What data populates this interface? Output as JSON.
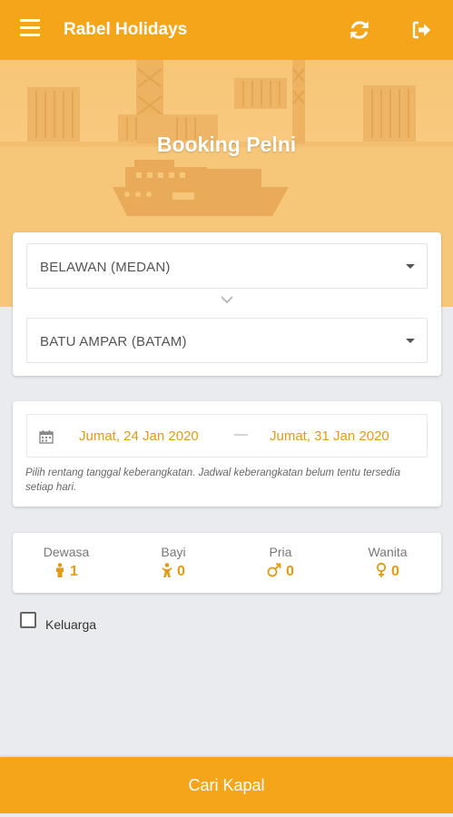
{
  "appbar": {
    "title": "Rabel Holidays",
    "icons": [
      "menu-icon",
      "refresh-icon",
      "logout-icon"
    ]
  },
  "hero": {
    "heading": "Booking Pelni"
  },
  "route": {
    "from": "BELAWAN (MEDAN)",
    "to": "BATU AMPAR (BATAM)"
  },
  "dates": {
    "start": "Jumat, 24 Jan 2020",
    "separator": "—",
    "end": "Jumat, 31 Jan 2020",
    "hint": "Pilih rentang tanggal keberangkatan. Jadwal keberangkatan belum tentu tersedia setiap hari."
  },
  "passengers": [
    {
      "label": "Dewasa",
      "count": "1",
      "icon": "adult-icon"
    },
    {
      "label": "Bayi",
      "count": "0",
      "icon": "infant-icon"
    },
    {
      "label": "Pria",
      "count": "0",
      "icon": "male-icon"
    },
    {
      "label": "Wanita",
      "count": "0",
      "icon": "female-icon"
    }
  ],
  "family_checkbox": {
    "label": "Keluarga",
    "checked": false
  },
  "search_button": {
    "label": "Cari Kapal"
  },
  "colors": {
    "primary": "#f5a51a",
    "accent_text": "#e29a17",
    "background": "#e9ebee"
  }
}
